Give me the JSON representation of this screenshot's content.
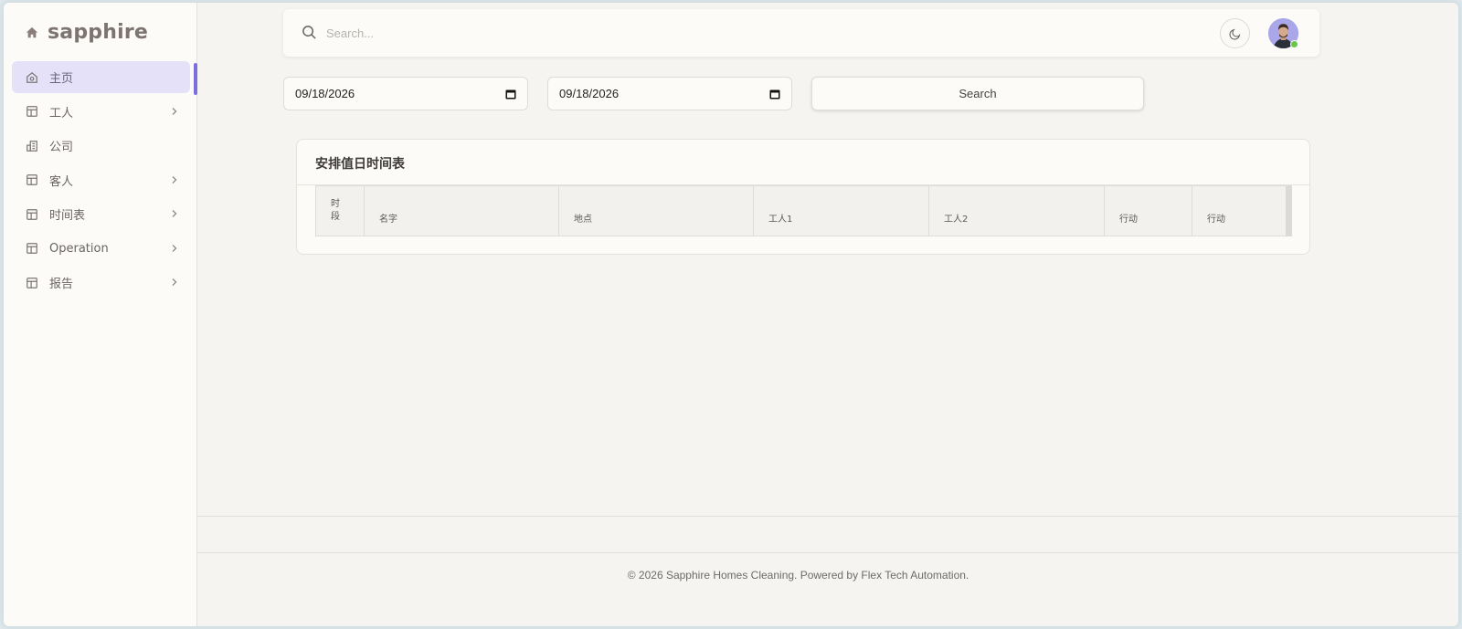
{
  "brand": {
    "name": "sapphire",
    "icon": "home-icon"
  },
  "sidebar": {
    "items": [
      {
        "label": "主页",
        "icon": "home-outline-icon",
        "active": true,
        "has_children": false
      },
      {
        "label": "工人",
        "icon": "layout-icon",
        "active": false,
        "has_children": true
      },
      {
        "label": "公司",
        "icon": "building-icon",
        "active": false,
        "has_children": false
      },
      {
        "label": "客人",
        "icon": "layout-icon",
        "active": false,
        "has_children": true
      },
      {
        "label": "时间表",
        "icon": "layout-icon",
        "active": false,
        "has_children": true
      },
      {
        "label": "Operation",
        "icon": "layout-icon",
        "active": false,
        "has_children": true
      },
      {
        "label": "报告",
        "icon": "layout-icon",
        "active": false,
        "has_children": true
      }
    ]
  },
  "topbar": {
    "search_placeholder": "Search...",
    "theme_icon": "moon-icon"
  },
  "filters": {
    "start_date": "09/18/2026",
    "end_date": "09/18/2026",
    "search_label": "Search"
  },
  "card": {
    "title": "安排值日时间表",
    "columns": [
      "时\n段",
      "名字",
      "地点",
      "工人1",
      "工人2",
      "行动",
      "行动"
    ]
  },
  "footer": {
    "text": "© 2026 Sapphire Homes Cleaning. Powered by Flex Tech Automation."
  },
  "colors": {
    "accent": "#7b6fe0",
    "active_bg": "#e5e1f8",
    "online": "#66c74a"
  }
}
